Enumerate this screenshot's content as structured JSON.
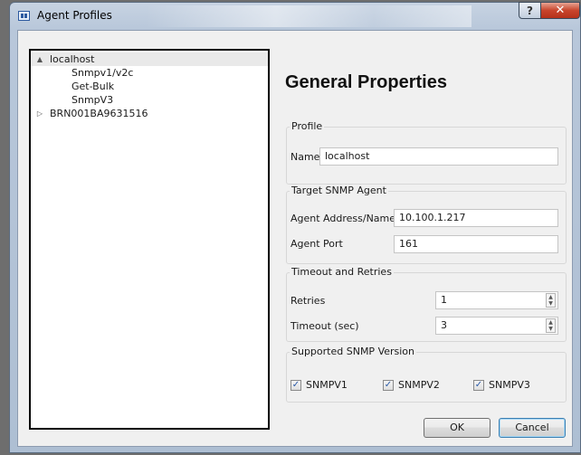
{
  "window": {
    "title": "Agent Profiles",
    "help_glyph": "?",
    "close_glyph": "✕"
  },
  "tree": {
    "items": [
      {
        "label": "localhost",
        "expand": "▲",
        "selected": true
      },
      {
        "label": "Snmpv1/v2c"
      },
      {
        "label": "Get-Bulk"
      },
      {
        "label": "SnmpV3"
      },
      {
        "label": "BRN001BA9631516",
        "expand": "▷"
      }
    ]
  },
  "heading": "General Properties",
  "profile": {
    "legend": "Profile",
    "name_label": "Name",
    "name_value": "localhost"
  },
  "target": {
    "legend": "Target SNMP Agent",
    "address_label": "Agent Address/Name",
    "address_value": "10.100.1.217",
    "port_label": "Agent Port",
    "port_value": "161"
  },
  "timeout": {
    "legend": "Timeout and Retries",
    "retries_label": "Retries",
    "retries_value": "1",
    "timeout_label": "Timeout (sec)",
    "timeout_value": "3"
  },
  "versions": {
    "legend": "Supported SNMP Version",
    "check_glyph": "✓",
    "items": [
      {
        "label": "SNMPV1",
        "checked": true
      },
      {
        "label": "SNMPV2",
        "checked": true
      },
      {
        "label": "SNMPV3",
        "checked": true
      }
    ]
  },
  "buttons": {
    "ok": "OK",
    "cancel": "Cancel"
  },
  "colors": {
    "close": "#c8452c",
    "default_button_border": "#3c7fb1"
  }
}
